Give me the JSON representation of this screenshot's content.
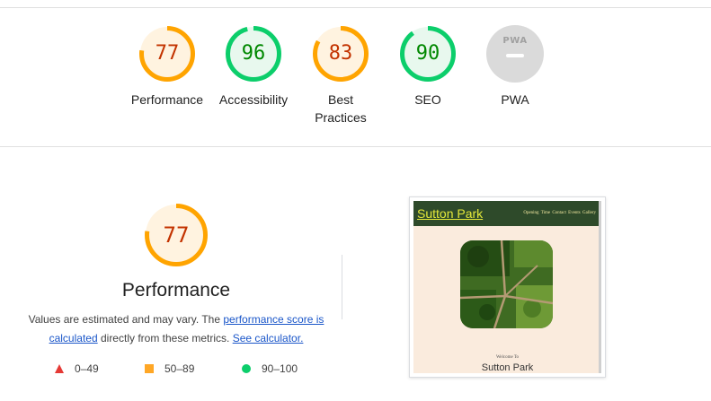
{
  "categories": [
    {
      "id": "performance",
      "score": "77",
      "score_value": 0.77,
      "label": "Performance",
      "status": "average",
      "color": "#ffa400",
      "text_color": "#c33300",
      "bg": "#fff3e0"
    },
    {
      "id": "accessibility",
      "score": "96",
      "score_value": 0.96,
      "label": "Accessibility",
      "status": "pass",
      "color": "#0cce6b",
      "text_color": "#008800",
      "bg": "#e8f8ee"
    },
    {
      "id": "best-practices",
      "score": "83",
      "score_value": 0.83,
      "label": "Best Practices",
      "status": "average",
      "color": "#ffa400",
      "text_color": "#c33300",
      "bg": "#fff3e0"
    },
    {
      "id": "seo",
      "score": "90",
      "score_value": 0.9,
      "label": "SEO",
      "status": "pass",
      "color": "#0cce6b",
      "text_color": "#008800",
      "bg": "#e8f8ee"
    },
    {
      "id": "pwa",
      "label": "PWA",
      "badge_text": "PWA",
      "status": "not-applicable",
      "color": "#dadada"
    }
  ],
  "performance": {
    "score": "77",
    "score_value": 0.77,
    "title": "Performance",
    "desc_prefix": "Values are estimated and may vary. The ",
    "score_link": "performance score is calculated",
    "desc_middle": " directly from these metrics. ",
    "calc_link": "See calculator."
  },
  "legend": [
    {
      "shape": "triangle-icon",
      "range": "0–49",
      "color": "#e53935"
    },
    {
      "shape": "square-icon",
      "range": "50–89",
      "color": "#ffa726"
    },
    {
      "shape": "circle-icon",
      "range": "90–100",
      "color": "#0cce6b"
    }
  ],
  "preview": {
    "site_title": "Sutton Park",
    "nav": "Opening Time Contact Events Gallery",
    "welcome": "Welcome To",
    "park_name": "Sutton Park"
  }
}
